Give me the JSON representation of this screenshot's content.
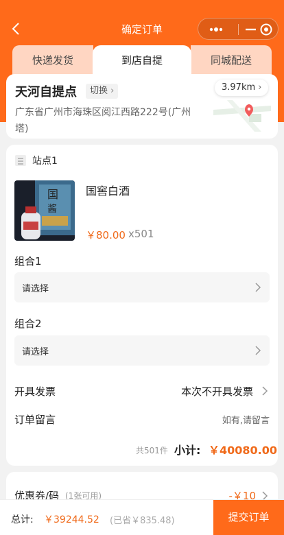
{
  "header": {
    "title": "确定订单"
  },
  "tabs": [
    {
      "label": "快递发货"
    },
    {
      "label": "到店自提"
    },
    {
      "label": "同城配送"
    }
  ],
  "store": {
    "name": "天河自提点",
    "switch_label": "切换",
    "address": "广东省广州市海珠区阅江西路222号(广州塔)",
    "distance": "3.97km"
  },
  "order": {
    "site_label": "站点1",
    "product": {
      "name": "国窖白酒",
      "price": "￥80.00",
      "qty": "x501"
    },
    "groups": [
      {
        "label": "组合1",
        "placeholder": "请选择"
      },
      {
        "label": "组合2",
        "placeholder": "请选择"
      }
    ],
    "invoice": {
      "label": "开具发票",
      "value": "本次不开具发票"
    },
    "message": {
      "label": "订单留言",
      "placeholder": "如有,请留言"
    },
    "count_text": "共501件",
    "subtotal_label": "小计:",
    "subtotal_value": "￥40080.00"
  },
  "coupon": {
    "label": "优惠券/码",
    "sub": "(1张可用)",
    "value": "-￥10"
  },
  "footer": {
    "total_label": "总计:",
    "total_value": "￥39244.52",
    "saved_text": "(已省￥835.48)",
    "submit_label": "提交订单"
  },
  "colors": {
    "accent": "#ff6a1a",
    "tab_inactive": "#ffd6c2",
    "price": "#f06a1a"
  }
}
